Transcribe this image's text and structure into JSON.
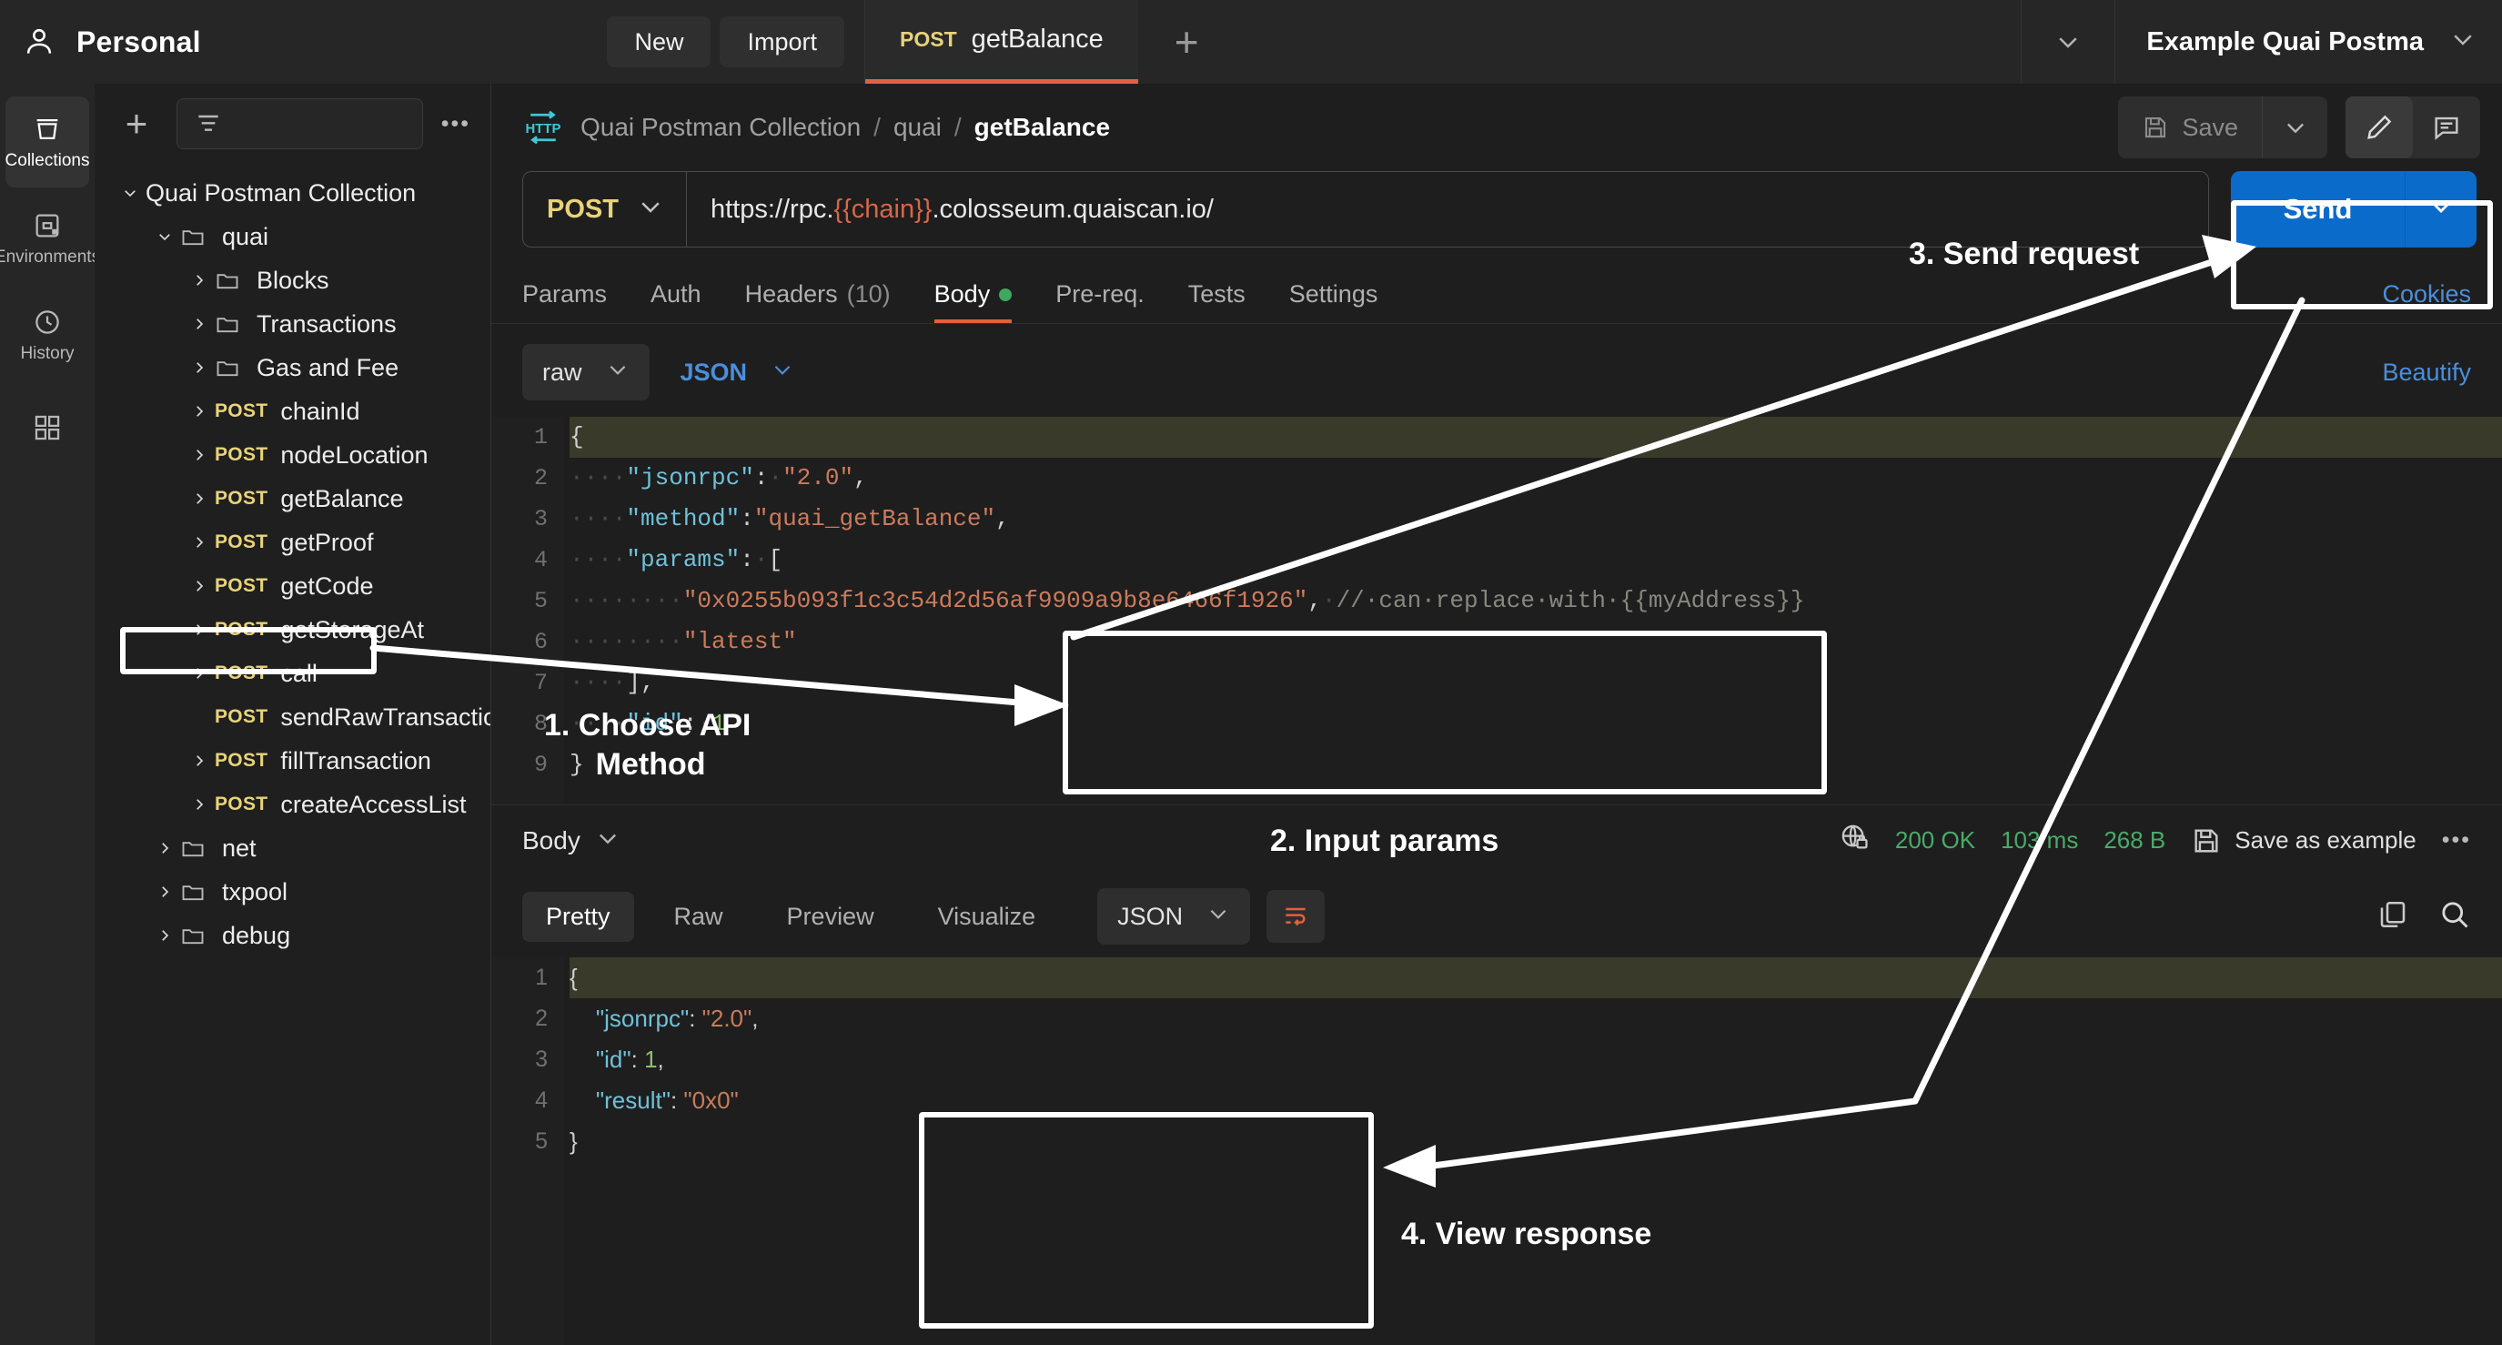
{
  "topbar": {
    "workspace": "Personal",
    "new_label": "New",
    "import_label": "Import",
    "tab": {
      "method": "POST",
      "name": "getBalance"
    },
    "add_tab": "+",
    "environment": "Example Quai Postma"
  },
  "rail": {
    "items": [
      {
        "label": "Collections",
        "icon": "collections-icon",
        "active": true
      },
      {
        "label": "Environments",
        "icon": "environments-icon",
        "active": false
      },
      {
        "label": "History",
        "icon": "history-icon",
        "active": false
      },
      {
        "label": "",
        "icon": "apps-icon",
        "active": false
      }
    ]
  },
  "sidebar": {
    "add_label": "+",
    "filter_placeholder": "",
    "more_label": "•••",
    "tree": [
      {
        "level": 0,
        "chev": "down",
        "icon": "none",
        "method": "",
        "name": "Quai Postman Collection"
      },
      {
        "level": 1,
        "chev": "down",
        "icon": "folder",
        "method": "",
        "name": "quai"
      },
      {
        "level": 2,
        "chev": "right",
        "icon": "folder",
        "method": "",
        "name": "Blocks"
      },
      {
        "level": 2,
        "chev": "right",
        "icon": "folder",
        "method": "",
        "name": "Transactions"
      },
      {
        "level": 2,
        "chev": "right",
        "icon": "folder",
        "method": "",
        "name": "Gas and Fee"
      },
      {
        "level": 2,
        "chev": "right",
        "icon": "none",
        "method": "POST",
        "name": "chainId"
      },
      {
        "level": 2,
        "chev": "right",
        "icon": "none",
        "method": "POST",
        "name": "nodeLocation"
      },
      {
        "level": 2,
        "chev": "right",
        "icon": "none",
        "method": "POST",
        "name": "getBalance"
      },
      {
        "level": 2,
        "chev": "right",
        "icon": "none",
        "method": "POST",
        "name": "getProof"
      },
      {
        "level": 2,
        "chev": "right",
        "icon": "none",
        "method": "POST",
        "name": "getCode"
      },
      {
        "level": 2,
        "chev": "right",
        "icon": "none",
        "method": "POST",
        "name": "getStorageAt"
      },
      {
        "level": 2,
        "chev": "right",
        "icon": "none",
        "method": "POST",
        "name": "call"
      },
      {
        "level": 2,
        "chev": "none",
        "icon": "none",
        "method": "POST",
        "name": "sendRawTransaction"
      },
      {
        "level": 2,
        "chev": "right",
        "icon": "none",
        "method": "POST",
        "name": "fillTransaction"
      },
      {
        "level": 2,
        "chev": "right",
        "icon": "none",
        "method": "POST",
        "name": "createAccessList"
      },
      {
        "level": 1,
        "chev": "right",
        "icon": "folder",
        "method": "",
        "name": "net"
      },
      {
        "level": 1,
        "chev": "right",
        "icon": "folder",
        "method": "",
        "name": "txpool"
      },
      {
        "level": 1,
        "chev": "right",
        "icon": "folder",
        "method": "",
        "name": "debug"
      }
    ]
  },
  "request": {
    "breadcrumb": {
      "collection": "Quai Postman Collection",
      "folder": "quai",
      "current": "getBalance",
      "sep": "/"
    },
    "save_label": "Save",
    "method": "POST",
    "url_prefix": "https://rpc.",
    "url_var": "{{chain}}",
    "url_suffix": ".colosseum.quaiscan.io/",
    "send_label": "Send",
    "tabs": [
      {
        "label": "Params",
        "count": "",
        "active": false,
        "dot": false
      },
      {
        "label": "Auth",
        "count": "",
        "active": false,
        "dot": false
      },
      {
        "label": "Headers",
        "count": "(10)",
        "active": false,
        "dot": false
      },
      {
        "label": "Body",
        "count": "",
        "active": true,
        "dot": true
      },
      {
        "label": "Pre-req.",
        "count": "",
        "active": false,
        "dot": false
      },
      {
        "label": "Tests",
        "count": "",
        "active": false,
        "dot": false
      },
      {
        "label": "Settings",
        "count": "",
        "active": false,
        "dot": false
      }
    ],
    "cookies_label": "Cookies",
    "beautify_label": "Beautify",
    "body_mode": "raw",
    "body_format": "JSON",
    "body_lines": [
      {
        "no": "1",
        "highlight": true,
        "tokens": [
          {
            "t": "p",
            "v": "{"
          }
        ]
      },
      {
        "no": "2",
        "highlight": false,
        "tokens": [
          {
            "t": "ws",
            "v": "····"
          },
          {
            "t": "k",
            "v": "\"jsonrpc\""
          },
          {
            "t": "p",
            "v": ":"
          },
          {
            "t": "ws",
            "v": "·"
          },
          {
            "t": "s",
            "v": "\"2.0\""
          },
          {
            "t": "p",
            "v": ","
          }
        ]
      },
      {
        "no": "3",
        "highlight": false,
        "tokens": [
          {
            "t": "ws",
            "v": "····"
          },
          {
            "t": "k",
            "v": "\"method\""
          },
          {
            "t": "p",
            "v": ":"
          },
          {
            "t": "s",
            "v": "\"quai_getBalance\""
          },
          {
            "t": "p",
            "v": ","
          }
        ]
      },
      {
        "no": "4",
        "highlight": false,
        "tokens": [
          {
            "t": "ws",
            "v": "····"
          },
          {
            "t": "k",
            "v": "\"params\""
          },
          {
            "t": "p",
            "v": ":"
          },
          {
            "t": "ws",
            "v": "·"
          },
          {
            "t": "p",
            "v": "["
          }
        ]
      },
      {
        "no": "5",
        "highlight": false,
        "tokens": [
          {
            "t": "ws",
            "v": "········"
          },
          {
            "t": "s",
            "v": "\"0x0255b093f1c3c54d2d56af9909a9b8e6466f1926\""
          },
          {
            "t": "p",
            "v": ","
          },
          {
            "t": "ws",
            "v": "·"
          },
          {
            "t": "cm",
            "v": "//·can·replace·with·{{myAddress}}"
          }
        ]
      },
      {
        "no": "6",
        "highlight": false,
        "tokens": [
          {
            "t": "ws",
            "v": "········"
          },
          {
            "t": "s",
            "v": "\"latest\""
          }
        ]
      },
      {
        "no": "7",
        "highlight": false,
        "tokens": [
          {
            "t": "ws",
            "v": "····"
          },
          {
            "t": "p",
            "v": "],"
          }
        ]
      },
      {
        "no": "8",
        "highlight": false,
        "tokens": [
          {
            "t": "ws",
            "v": "····"
          },
          {
            "t": "k",
            "v": "\"id\""
          },
          {
            "t": "p",
            "v": ":"
          },
          {
            "t": "ws",
            "v": "·"
          },
          {
            "t": "n",
            "v": "1"
          }
        ]
      },
      {
        "no": "9",
        "highlight": false,
        "tokens": [
          {
            "t": "p",
            "v": "}"
          }
        ]
      }
    ]
  },
  "response": {
    "body_label": "Body",
    "status": "200 OK",
    "time": "103 ms",
    "size": "268 B",
    "save_example_label": "Save as example",
    "more_label": "•••",
    "tabs": [
      {
        "label": "Pretty",
        "active": true
      },
      {
        "label": "Raw",
        "active": false
      },
      {
        "label": "Preview",
        "active": false
      },
      {
        "label": "Visualize",
        "active": false
      }
    ],
    "format": "JSON",
    "lines": [
      {
        "no": "1",
        "highlight": true,
        "tokens": [
          {
            "t": "p",
            "v": "{"
          }
        ]
      },
      {
        "no": "2",
        "highlight": false,
        "tokens": [
          {
            "t": "ws",
            "v": "    "
          },
          {
            "t": "k",
            "v": "\"jsonrpc\""
          },
          {
            "t": "p",
            "v": ": "
          },
          {
            "t": "s",
            "v": "\"2.0\""
          },
          {
            "t": "p",
            "v": ","
          }
        ]
      },
      {
        "no": "3",
        "highlight": false,
        "tokens": [
          {
            "t": "ws",
            "v": "    "
          },
          {
            "t": "k",
            "v": "\"id\""
          },
          {
            "t": "p",
            "v": ": "
          },
          {
            "t": "n",
            "v": "1"
          },
          {
            "t": "p",
            "v": ","
          }
        ]
      },
      {
        "no": "4",
        "highlight": false,
        "tokens": [
          {
            "t": "ws",
            "v": "    "
          },
          {
            "t": "k",
            "v": "\"result\""
          },
          {
            "t": "p",
            "v": ": "
          },
          {
            "t": "s",
            "v": "\"0x0\""
          }
        ]
      },
      {
        "no": "5",
        "highlight": false,
        "tokens": [
          {
            "t": "p",
            "v": "}"
          }
        ]
      }
    ]
  },
  "annotations": [
    {
      "id": "step1",
      "text": "1. Choose API\n      Method"
    },
    {
      "id": "step2",
      "text": "2. Input params"
    },
    {
      "id": "step3",
      "text": "3. Send request"
    },
    {
      "id": "step4",
      "text": "4. View response"
    }
  ],
  "colors": {
    "accent_orange": "#e2603f",
    "send_blue": "#0b6bcb",
    "method_yellow": "#e8d37a",
    "status_green": "#4aab6a",
    "link_blue": "#4a8fdc",
    "http_cyan": "#3ec8d8"
  }
}
